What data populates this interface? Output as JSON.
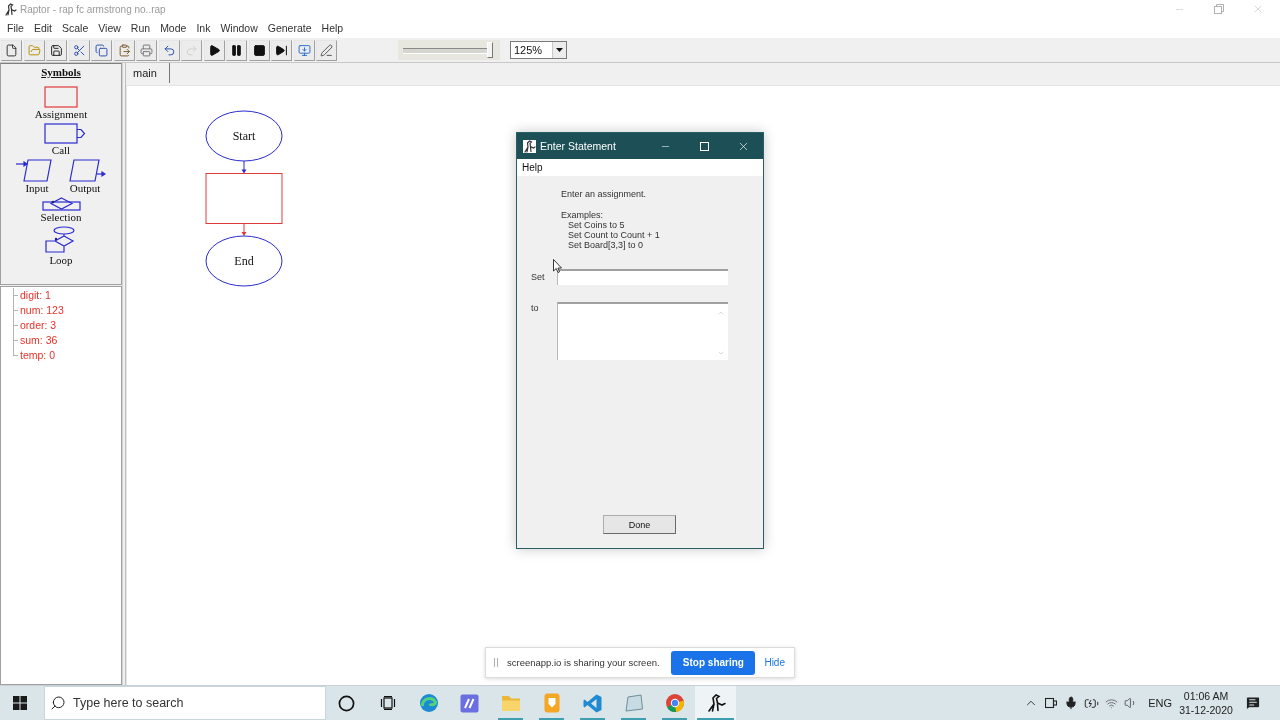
{
  "window": {
    "title": "Raptor - rap fc armstrong no..rap"
  },
  "menu": [
    "File",
    "Edit",
    "Scale",
    "View",
    "Run",
    "Mode",
    "Ink",
    "Window",
    "Generate",
    "Help"
  ],
  "toolbar": {
    "buttons": [
      {
        "kind": "new",
        "disabled": false
      },
      {
        "kind": "open",
        "disabled": false
      },
      {
        "kind": "save",
        "disabled": false
      },
      {
        "kind": "cut",
        "disabled": false
      },
      {
        "kind": "copy",
        "disabled": false
      },
      {
        "kind": "paste",
        "disabled": false
      },
      {
        "kind": "print",
        "disabled": false
      },
      {
        "kind": "undo",
        "disabled": false
      },
      {
        "kind": "redo",
        "disabled": true
      },
      {
        "kind": "run",
        "disabled": false
      },
      {
        "kind": "pause",
        "disabled": false
      },
      {
        "kind": "stop",
        "disabled": false
      },
      {
        "kind": "step",
        "disabled": false
      },
      {
        "kind": "monitor",
        "disabled": false
      },
      {
        "kind": "pen",
        "disabled": false
      }
    ],
    "slider": {
      "level": 1
    },
    "zoom": "125%"
  },
  "symbols": {
    "title": "Symbols",
    "items": [
      {
        "kind": "assignment",
        "label": "Assignment",
        "selected": true
      },
      {
        "kind": "call",
        "label": "Call",
        "selected": false
      },
      {
        "kind": "input",
        "label": "Input",
        "selected": false
      },
      {
        "kind": "output",
        "label": "Output",
        "selected": false
      },
      {
        "kind": "selection",
        "label": "Selection",
        "selected": false
      },
      {
        "kind": "loop",
        "label": "Loop",
        "selected": false
      }
    ]
  },
  "variables": [
    "digit: 1",
    "num: 123",
    "order: 3",
    "sum: 36",
    "temp: 0"
  ],
  "tabs": [
    {
      "label": "main",
      "selected": true
    }
  ],
  "flowchart": {
    "nodes": [
      {
        "kind": "terminal",
        "label": "Start",
        "selected": false
      },
      {
        "kind": "assignment",
        "selected": true
      },
      {
        "kind": "terminal",
        "label": "End",
        "selected": false
      }
    ]
  },
  "dialog": {
    "title": "Enter Statement",
    "menu": [
      "Help"
    ],
    "prompt": "Enter an assignment.",
    "examples_heading": "Examples:",
    "examples": [
      "Set Coins to 5",
      "Set Count to Count + 1",
      "Set Board[3,3] to 0"
    ],
    "fields": [
      {
        "kind": "line",
        "label": "Set"
      },
      {
        "kind": "area",
        "label": "to"
      }
    ],
    "button": "Done"
  },
  "share_banner": {
    "message": "screenapp.io is sharing your screen.",
    "button": "Stop sharing",
    "link": "Hide"
  },
  "taskbar": {
    "search": {
      "placeholder": "Type here to search"
    },
    "apps": [
      {
        "kind": "swirl",
        "running": false,
        "active": false
      },
      {
        "kind": "tile",
        "running": false,
        "active": false
      },
      {
        "kind": "folder",
        "running": true,
        "active": false
      },
      {
        "kind": "note",
        "running": true,
        "active": false
      },
      {
        "kind": "ribbon",
        "running": true,
        "active": false
      },
      {
        "kind": "tablet",
        "running": true,
        "active": false
      },
      {
        "kind": "wheel",
        "running": true,
        "active": false
      },
      {
        "kind": "dinosaur",
        "running": true,
        "active": true
      }
    ],
    "tray": {
      "language": "ENG",
      "time": "01:06 AM",
      "date": "31-12-2020"
    }
  }
}
